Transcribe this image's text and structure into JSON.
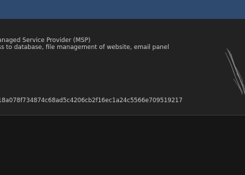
{
  "listing": {
    "category": "anaged Service Provider (MSP)",
    "description": "ss to database, file management of website, email panel",
    "hash": "18a078f734874c68ad5c4206cb2f16ec1a24c5566e709519217",
    "watermark_icon": "bird-sketch-icon"
  }
}
